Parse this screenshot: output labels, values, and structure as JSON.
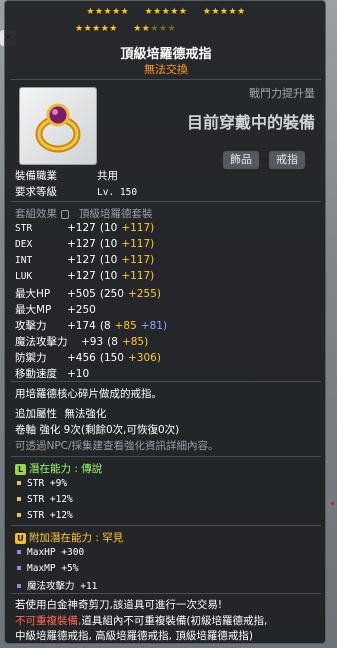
{
  "stars": {
    "row1": [
      "★★★★★",
      "★★★★★",
      "★★★★★"
    ],
    "row2": [
      "★★★★★",
      "★★"
    ],
    "row2_dim": "★★★"
  },
  "item": {
    "name": "頂級培羅德戒指",
    "trade": "無法交換"
  },
  "compare": {
    "label": "戰鬥力提升量",
    "value": "目前穿戴中的裝備"
  },
  "tags": [
    "飾品",
    "戒指"
  ],
  "requirements": [
    {
      "label": "裝備職業",
      "value": "共用"
    },
    {
      "label": "要求等級",
      "value": "Lv. 150"
    }
  ],
  "set": {
    "label": "套組效果",
    "value": "頂級培羅德套裝"
  },
  "stats": [
    {
      "label": "STR",
      "total": "+127",
      "base": "(10",
      "bonus": "+117)",
      "extra": ""
    },
    {
      "label": "DEX",
      "total": "+127",
      "base": "(10",
      "bonus": "+117)",
      "extra": ""
    },
    {
      "label": "INT",
      "total": "+127",
      "base": "(10",
      "bonus": "+117)",
      "extra": ""
    },
    {
      "label": "LUK",
      "total": "+127",
      "base": "(10",
      "bonus": "+117)",
      "extra": ""
    },
    {
      "label": "最大HP",
      "total": "+505",
      "base": "(250",
      "bonus": "+255)",
      "extra": ""
    },
    {
      "label": "最大MP",
      "total": "+250",
      "base": "",
      "bonus": "",
      "extra": ""
    },
    {
      "label": "攻擊力",
      "total": "+174",
      "base": "(8",
      "bonus": "+85",
      "extra": "+81)"
    },
    {
      "label": "魔法攻擊力",
      "total": "+93",
      "base": "(8",
      "bonus": "+85)",
      "extra": ""
    },
    {
      "label": "防禦力",
      "total": "+456",
      "base": "(150",
      "bonus": "+306)",
      "extra": ""
    },
    {
      "label": "移動速度",
      "total": "+10",
      "base": "",
      "bonus": "",
      "extra": ""
    }
  ],
  "description": "用培羅德核心碎片做成的戒指。",
  "extra_attr": {
    "label": "追加屬性",
    "value": "無法強化"
  },
  "scroll": "卷軸 強化 9次(剩餘0次,可恢復0次)",
  "starforce_note": "可透過NPC/採集建查看強化資訊詳細內容。",
  "potential": {
    "badge": "L",
    "badge_color": "#9bd93a",
    "title": "潛在能力 : 傳說",
    "lines": [
      "STR +9%",
      "STR +12%",
      "STR +12%"
    ],
    "bullet_color": "#e0c84a"
  },
  "additional": {
    "badge": "U",
    "badge_color": "#f2c21a",
    "title": "附加潛在能力 : 罕見",
    "lines": [
      "MaxHP +300",
      "MaxMP +5%",
      "魔法攻擊力 +11"
    ],
    "bullet_color": "#b07ae8"
  },
  "footer": {
    "line1": "若使用白金神奇剪刀,該道具可進行一次交易!",
    "line2_red": "不可重複裝備,",
    "line2_rest": "道具組內不可重複裝備(初級培羅德戒指,",
    "line3": "中級培羅德戒指, 高級培羅德戒指, 頂級培羅德戒指)"
  },
  "colors": {
    "accent": "#ffcc22",
    "trade": "#ff9a1a",
    "bonus_blue": "#8da6ff"
  }
}
